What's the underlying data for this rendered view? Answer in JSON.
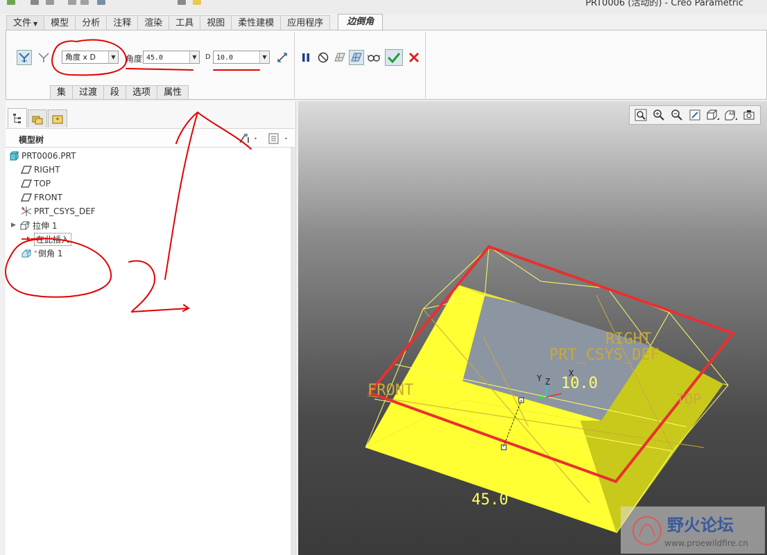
{
  "window": {
    "title": "PRT0006 (活动的) - Creo Parametric"
  },
  "ribbon": {
    "tabs": [
      "文件",
      "模型",
      "分析",
      "注释",
      "渲染",
      "工具",
      "视图",
      "柔性建模",
      "应用程序"
    ],
    "active_tab": "边倒角",
    "scheme_value": "角度 x D",
    "angle_label": "角度",
    "angle_value": "45.0",
    "d_label": "D",
    "d_value": "10.0",
    "subtabs": [
      "集",
      "过渡",
      "段",
      "选项",
      "属性"
    ]
  },
  "panel": {
    "tree_title": "模型树",
    "nodes": [
      "PRT0006.PRT",
      "RIGHT",
      "TOP",
      "FRONT",
      "PRT_CSYS_DEF",
      "拉伸 1",
      "在此插入",
      "倒角 1"
    ]
  },
  "viewport": {
    "labels": {
      "front": "FRONT",
      "right": "RIGHT",
      "top": "TOP",
      "csys": "PRT_CSYS_DEF",
      "dim_d": "10.0",
      "dim_angle": "45.0",
      "axis_y": "Y",
      "axis_z": "Z",
      "axis_x": "X"
    },
    "watermark": {
      "name": "野火论坛",
      "url": "www.proewildfire.cn"
    },
    "colors": {
      "model": "#ffff33",
      "model_shade": "#c9c91c",
      "top_face": "#8c95a2",
      "edge_highlight": "#e83030",
      "datum": "#c9a93a"
    }
  },
  "annotations": {
    "color": "#e00000"
  }
}
